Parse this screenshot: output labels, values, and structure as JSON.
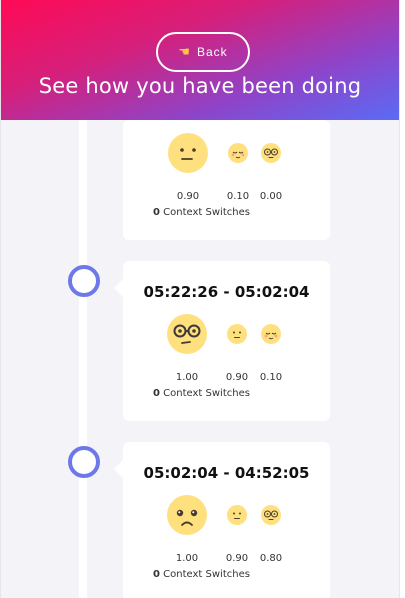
{
  "header": {
    "back_label": "Back",
    "title": "See how you have been doing"
  },
  "colors": {
    "gradient_start": "#ff0a55",
    "gradient_end": "#5a6bf5",
    "timeline_dot": "#6e78e8",
    "emoji_fill": "#ffe07f"
  },
  "entries": [
    {
      "time_range": "",
      "faces": [
        "neutral-face-icon",
        "relieved-face-icon",
        "nerd-face-icon"
      ],
      "values": [
        "0.90",
        "0.10",
        "0.00"
      ],
      "context_switches": "0",
      "context_label": "Context Switches"
    },
    {
      "time_range": "05:22:26 - 05:02:04",
      "faces": [
        "nerd-face-icon",
        "neutral-face-icon",
        "relieved-face-icon"
      ],
      "values": [
        "1.00",
        "0.90",
        "0.10"
      ],
      "context_switches": "0",
      "context_label": "Context Switches"
    },
    {
      "time_range": "05:02:04 - 04:52:05",
      "faces": [
        "worried-face-icon",
        "neutral-face-icon",
        "nerd-face-icon"
      ],
      "values": [
        "1.00",
        "0.90",
        "0.80"
      ],
      "context_switches": "0",
      "context_label": "Context Switches"
    }
  ]
}
